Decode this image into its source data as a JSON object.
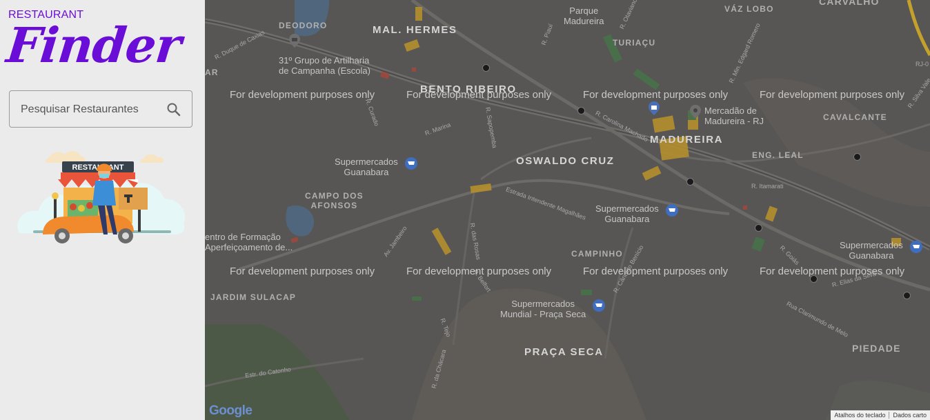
{
  "brand": {
    "small": "RESTAURANT",
    "big": "Finder"
  },
  "search": {
    "placeholder": "Pesquisar Restaurantes",
    "icon": "search-icon"
  },
  "illustration": {
    "sign_text": "RESTAURANT"
  },
  "map": {
    "watermark": "For development purposes only",
    "neighborhoods": {
      "mal_hermes": "MAL. HERMES",
      "bento_ribeiro": "BENTO RIBEIRO",
      "oswaldo_cruz": "OSWALDO CRUZ",
      "madureira": "MADUREIRA",
      "campinho": "CAMPINHO",
      "praca_seca": "PRAÇA SECA",
      "campo_dos_afonsos": "CAMPO DOS\nAFONSOS",
      "jardim_sulacap": "JARDIM SULACAP",
      "piedade": "PIEDADE",
      "vaz_lobo": "VÁZ LOBO",
      "carvalho": "CARVALHO",
      "turiacu": "TURIAÇU",
      "cavalcante": "CAVALCANTE",
      "eng_leal": "ENG. LEAL",
      "deodoro": "DEODORO",
      "ar": "AR"
    },
    "pois": {
      "parque_madureira": "Parque\nMadureira",
      "grupo_artilharia": "31º Grupo de Artilharia\nde Campanha (Escola)",
      "mercadao": "Mercadão de\nMadureira - RJ",
      "super_guanabara_1": "Supermercados\nGuanabara",
      "super_guanabara_2": "Supermercados\nGuanabara",
      "super_guanabara_3": "Supermercados\nGuanabara",
      "super_mundial": "Supermercados\nMundial - Praça Seca",
      "centro_formacao": "entro de Formação\nAperfeiçoamento de..."
    },
    "streets": {
      "duque_caxias": "R. Duque de Caxias",
      "curado": "R. Curado",
      "marina": "R. Marina",
      "sapopemba": "R. Sapopemba",
      "piaui": "R. Piauí",
      "carolina_machado": "R. Carolina Machado",
      "intendente": "Estrada Intendente Magalhães",
      "jambeiro": "Av. Jambeiro",
      "rosas": "R. das Rosas",
      "belfort": "R. Belfort",
      "canai": "R. Cândido Benício",
      "tejo": "R. Tejo",
      "chacara": "R. da Chácara",
      "catonho": "Estr. do Catonho",
      "itamarati": "R. Itamarati",
      "goias": "R. Goiás",
      "elias": "R. Elias da Silva",
      "clarimundo": "Rua Clarimundo de Melo",
      "edgard": "R. Min. Edgard Romero",
      "otaviano": "R. Otaviano",
      "silva_vale": "R. Silva Vale",
      "rj": "RJ-0"
    },
    "attribution": {
      "shortcuts": "Atalhos do teclado",
      "data": "Dados carto"
    },
    "google_logo": "Google"
  }
}
